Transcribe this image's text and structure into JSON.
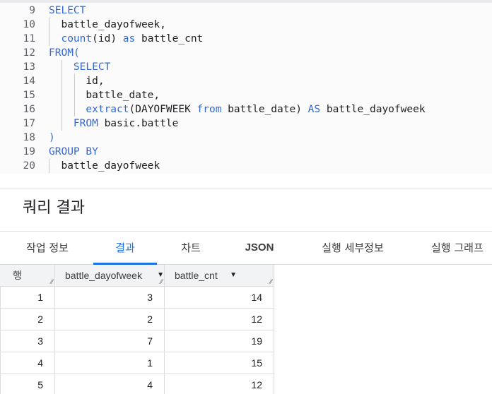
{
  "editor": {
    "lines": [
      {
        "num": "9",
        "tokens": [
          {
            "t": "SELECT",
            "c": "kw"
          }
        ]
      },
      {
        "num": "10",
        "tokens": [
          {
            "t": "  battle_dayofweek,",
            "c": "id"
          }
        ]
      },
      {
        "num": "11",
        "tokens": [
          {
            "t": "  ",
            "c": "id"
          },
          {
            "t": "count",
            "c": "kw"
          },
          {
            "t": "(id) ",
            "c": "id"
          },
          {
            "t": "as",
            "c": "kw"
          },
          {
            "t": " battle_cnt",
            "c": "id"
          }
        ]
      },
      {
        "num": "12",
        "tokens": [
          {
            "t": "FROM(",
            "c": "kw"
          }
        ]
      },
      {
        "num": "13",
        "tokens": [
          {
            "t": "    ",
            "c": "id"
          },
          {
            "t": "SELECT",
            "c": "kw"
          }
        ]
      },
      {
        "num": "14",
        "tokens": [
          {
            "t": "      id,",
            "c": "id"
          }
        ]
      },
      {
        "num": "15",
        "tokens": [
          {
            "t": "      battle_date,",
            "c": "id"
          }
        ]
      },
      {
        "num": "16",
        "tokens": [
          {
            "t": "      ",
            "c": "id"
          },
          {
            "t": "extract",
            "c": "kw"
          },
          {
            "t": "(DAYOFWEEK ",
            "c": "id"
          },
          {
            "t": "from",
            "c": "kw"
          },
          {
            "t": " battle_date) ",
            "c": "id"
          },
          {
            "t": "AS",
            "c": "kw"
          },
          {
            "t": " battle_dayofweek",
            "c": "id"
          }
        ]
      },
      {
        "num": "17",
        "tokens": [
          {
            "t": "    ",
            "c": "id"
          },
          {
            "t": "FROM",
            "c": "kw"
          },
          {
            "t": " basic.battle",
            "c": "id"
          }
        ]
      },
      {
        "num": "18",
        "tokens": [
          {
            "t": ")",
            "c": "kw"
          }
        ]
      },
      {
        "num": "19",
        "tokens": [
          {
            "t": "GROUP BY",
            "c": "kw"
          }
        ]
      },
      {
        "num": "20",
        "tokens": [
          {
            "t": "  battle_dayofweek",
            "c": "id"
          }
        ]
      }
    ]
  },
  "results": {
    "title": "쿼리 결과",
    "tabs": {
      "job_info": "작업 정보",
      "results": "결과",
      "chart": "차트",
      "json": "JSON",
      "exec_details": "실행 세부정보",
      "exec_graph": "실행 그래프"
    },
    "columns": {
      "row": "행",
      "dayofweek": "battle_dayofweek",
      "cnt": "battle_cnt"
    },
    "rows": [
      {
        "row": "1",
        "dayofweek": "3",
        "cnt": "14"
      },
      {
        "row": "2",
        "dayofweek": "2",
        "cnt": "12"
      },
      {
        "row": "3",
        "dayofweek": "7",
        "cnt": "19"
      },
      {
        "row": "4",
        "dayofweek": "1",
        "cnt": "15"
      },
      {
        "row": "5",
        "dayofweek": "4",
        "cnt": "12"
      }
    ]
  },
  "icons": {
    "sort": "triangle-down",
    "resize": "resize-handle"
  },
  "colors": {
    "keyword": "#3367d6",
    "active_tab": "#1a73e8"
  }
}
